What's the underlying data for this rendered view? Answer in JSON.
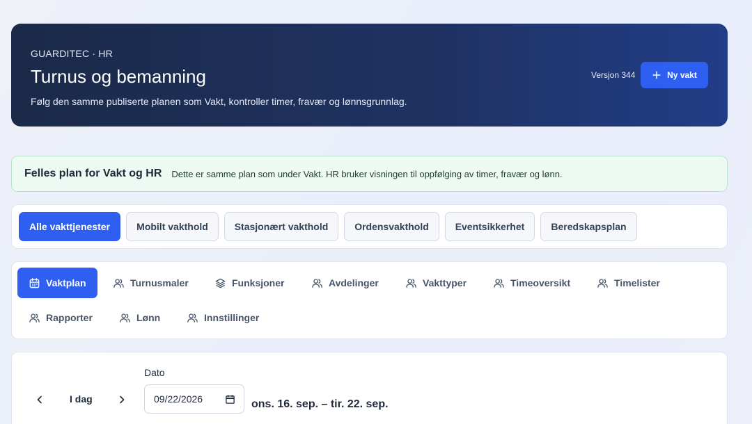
{
  "hero": {
    "eyebrow": "GUARDITEC · HR",
    "title": "Turnus og bemanning",
    "subtitle": "Følg den samme publiserte planen som Vakt, kontroller timer, fravær og lønnsgrunnlag.",
    "version": "Versjon 344",
    "new_button": "Ny vakt"
  },
  "notice": {
    "title": "Felles plan for Vakt og HR",
    "text": "Dette er samme plan som under Vakt. HR bruker visningen til oppfølging av timer, fravær og lønn."
  },
  "filters": [
    {
      "label": "Alle vakttjenester",
      "active": true
    },
    {
      "label": "Mobilt vakthold",
      "active": false
    },
    {
      "label": "Stasjonært vakthold",
      "active": false
    },
    {
      "label": "Ordensvakthold",
      "active": false
    },
    {
      "label": "Eventsikkerhet",
      "active": false
    },
    {
      "label": "Beredskapsplan",
      "active": false
    }
  ],
  "tabs": [
    {
      "label": "Vaktplan",
      "icon": "calendar-icon",
      "active": true
    },
    {
      "label": "Turnusmaler",
      "icon": "users-icon",
      "active": false
    },
    {
      "label": "Funksjoner",
      "icon": "layers-icon",
      "active": false
    },
    {
      "label": "Avdelinger",
      "icon": "users-icon",
      "active": false
    },
    {
      "label": "Vakttyper",
      "icon": "users-icon",
      "active": false
    },
    {
      "label": "Timeoversikt",
      "icon": "users-icon",
      "active": false
    },
    {
      "label": "Timelister",
      "icon": "users-icon",
      "active": false
    },
    {
      "label": "Rapporter",
      "icon": "users-icon",
      "active": false
    },
    {
      "label": "Lønn",
      "icon": "users-icon",
      "active": false
    },
    {
      "label": "Innstillinger",
      "icon": "users-icon",
      "active": false
    }
  ],
  "date_nav": {
    "today_label": "I dag",
    "date_label": "Dato",
    "date_value": "09/22/2026",
    "range_text": "ons. 16. sep. – tir. 22. sep."
  },
  "colors": {
    "accent": "#2f5ff0",
    "hero_bg": "#1b2a48",
    "notice_bg": "#eef9f3"
  }
}
